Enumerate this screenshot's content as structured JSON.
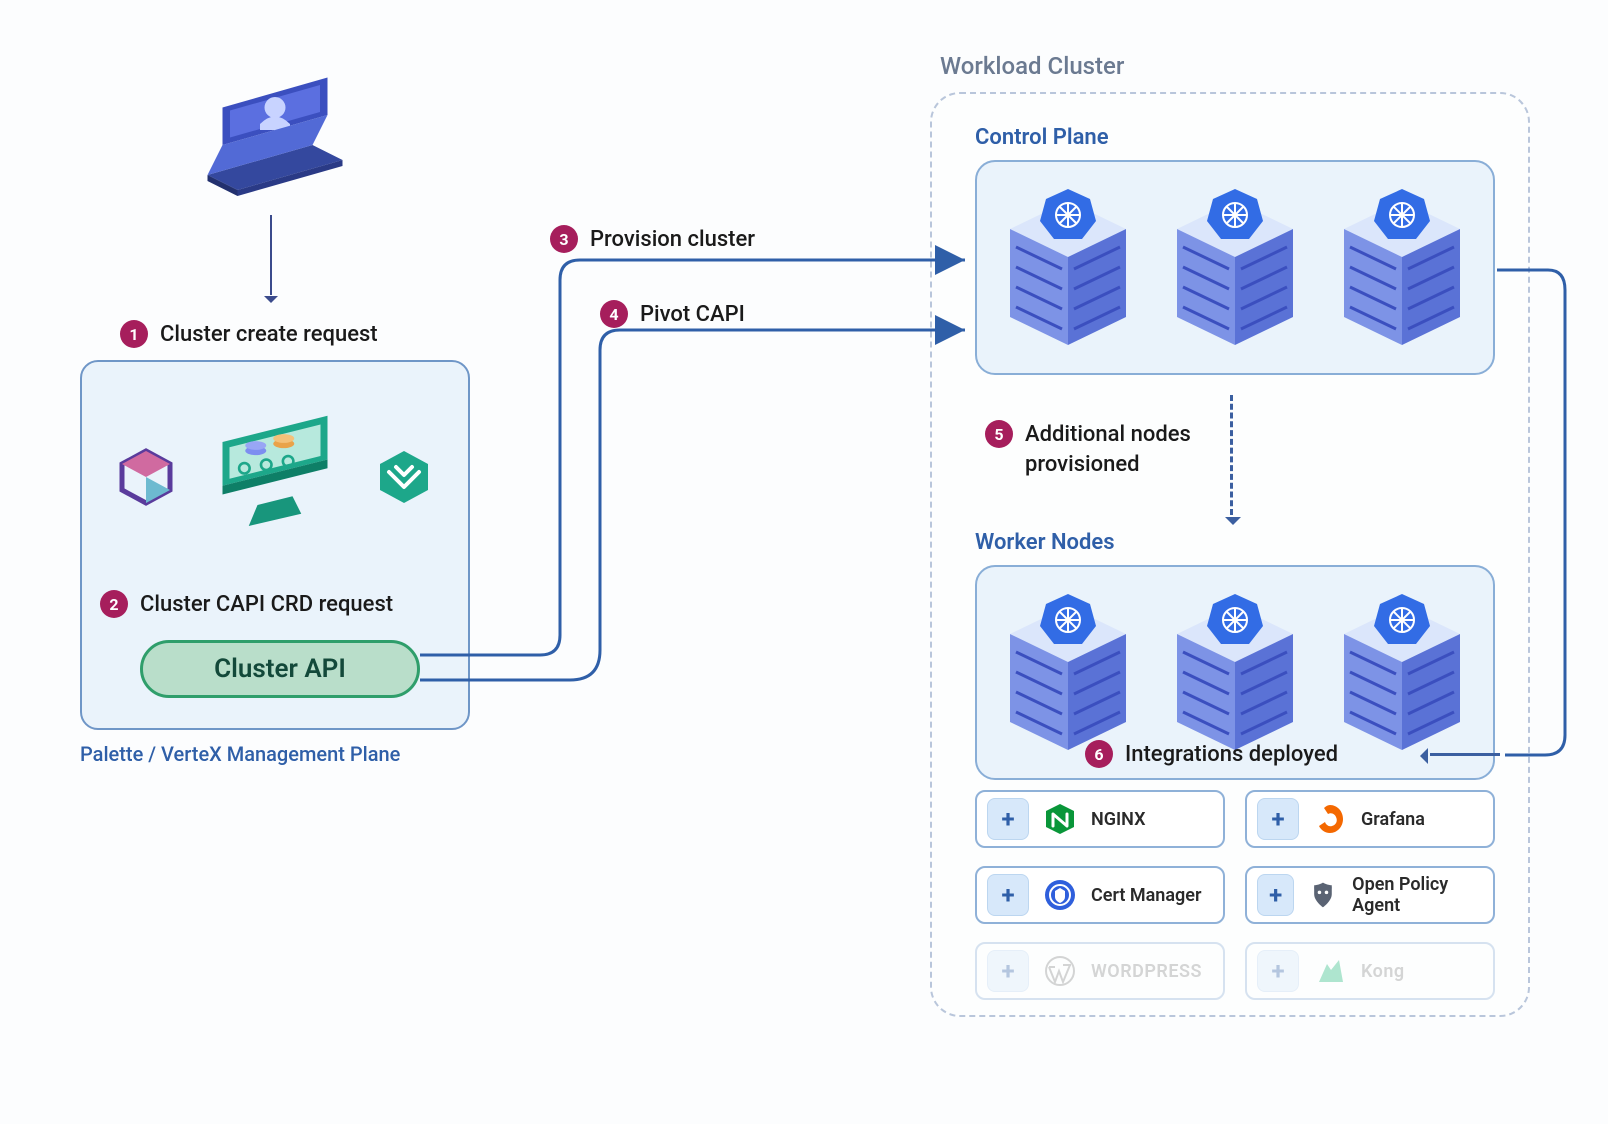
{
  "steps": {
    "s1": {
      "num": "1",
      "label": "Cluster create request"
    },
    "s2": {
      "num": "2",
      "label": "Cluster CAPI CRD request"
    },
    "s3": {
      "num": "3",
      "label": "Provision cluster"
    },
    "s4": {
      "num": "4",
      "label": "Pivot CAPI"
    },
    "s5": {
      "num": "5",
      "label": "Additional nodes\nprovisioned"
    },
    "s6": {
      "num": "6",
      "label": "Integrations deployed"
    }
  },
  "mgmt": {
    "api_pill": "Cluster API",
    "caption": "Palette / VerteX Management Plane"
  },
  "workload": {
    "title": "Workload Cluster",
    "control_plane_title": "Control Plane",
    "worker_nodes_title": "Worker Nodes"
  },
  "integrations": [
    {
      "name": "NGINX",
      "icon": "nginx",
      "faded": false
    },
    {
      "name": "Grafana",
      "icon": "grafana",
      "faded": false
    },
    {
      "name": "Cert Manager",
      "icon": "certmanager",
      "faded": false
    },
    {
      "name": "Open Policy Agent",
      "icon": "opa",
      "faded": false
    },
    {
      "name": "WORDPRESS",
      "icon": "wordpress",
      "faded": true
    },
    {
      "name": "Kong",
      "icon": "kong",
      "faded": true
    }
  ],
  "colors": {
    "badge": "#a61e5c",
    "panel_border": "#89aed7",
    "panel_bg": "#eaf3fb",
    "connector": "#2f5fa8",
    "pill_bg": "#b9deca",
    "pill_border": "#2f9e6b"
  }
}
